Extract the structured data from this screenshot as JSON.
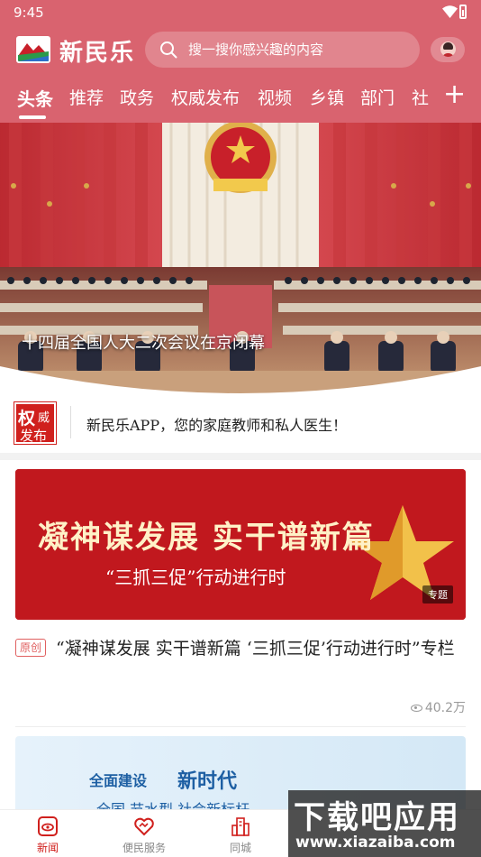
{
  "status_bar": {
    "time": "9:45"
  },
  "header": {
    "brand": "新民乐",
    "search_placeholder": "搜一搜你感兴趣的内容"
  },
  "tabs": [
    {
      "label": "头条",
      "active": true
    },
    {
      "label": "推荐",
      "active": false
    },
    {
      "label": "政务",
      "active": false
    },
    {
      "label": "权威发布",
      "active": false
    },
    {
      "label": "视频",
      "active": false
    },
    {
      "label": "乡镇",
      "active": false
    },
    {
      "label": "部门",
      "active": false
    },
    {
      "label": "社",
      "active": false
    }
  ],
  "tab_add": "+",
  "banner": {
    "title": "十四届全国人大二次会议在京闭幕"
  },
  "announcement": {
    "badge_1": "权",
    "badge_2": "威",
    "badge_3": "发布",
    "text": "新民乐APP，您的家庭教师和私人医生！"
  },
  "article_1": {
    "image_slogan": "凝神谋发展  实干谱新篇",
    "image_sub": "“三抓三促”行动进行时",
    "image_tag": "专题",
    "original_tag": "原创",
    "title": "“凝神谋发展 实干谱新篇 ‘三抓三促’行动进行时”专栏",
    "views": "40.2万"
  },
  "article_2": {
    "line_a": "全面建设",
    "line_b": "新时代",
    "line_c": "全国  节水型  社会新标杆"
  },
  "bottom_nav": [
    {
      "label": "新闻",
      "icon": "news-icon",
      "active": true
    },
    {
      "label": "便民服务",
      "icon": "service-icon",
      "active": false
    },
    {
      "label": "同城",
      "icon": "city-icon",
      "active": false
    }
  ],
  "watermark": {
    "line_1": "下载吧应用",
    "line_2": "www.xiazaiba.com"
  },
  "colors": {
    "brand_red": "#d9636f",
    "accent_red": "#d0201d"
  }
}
